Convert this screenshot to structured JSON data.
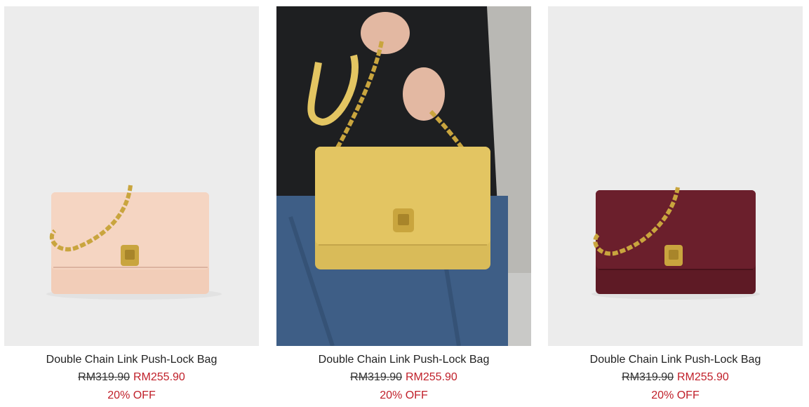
{
  "colors": {
    "price_sale": "#c0202a",
    "image_bg": "#ededed",
    "bag_pink": "#f2cdb8",
    "bag_yellow": "#e3c562",
    "bag_burgundy": "#5e1a25",
    "hardware_gold": "#c9a53e"
  },
  "products": [
    {
      "name": "Double Chain Link Push-Lock Bag",
      "original_price": "RM319.90",
      "sale_price": "RM255.90",
      "discount": "20% OFF",
      "image": "pink-chain-bag-product-photo"
    },
    {
      "name": "Double Chain Link Push-Lock Bag",
      "original_price": "RM319.90",
      "sale_price": "RM255.90",
      "discount": "20% OFF",
      "image": "yellow-chain-bag-model-photo"
    },
    {
      "name": "Double Chain Link Push-Lock Bag",
      "original_price": "RM319.90",
      "sale_price": "RM255.90",
      "discount": "20% OFF",
      "image": "burgundy-chain-bag-product-photo"
    }
  ]
}
